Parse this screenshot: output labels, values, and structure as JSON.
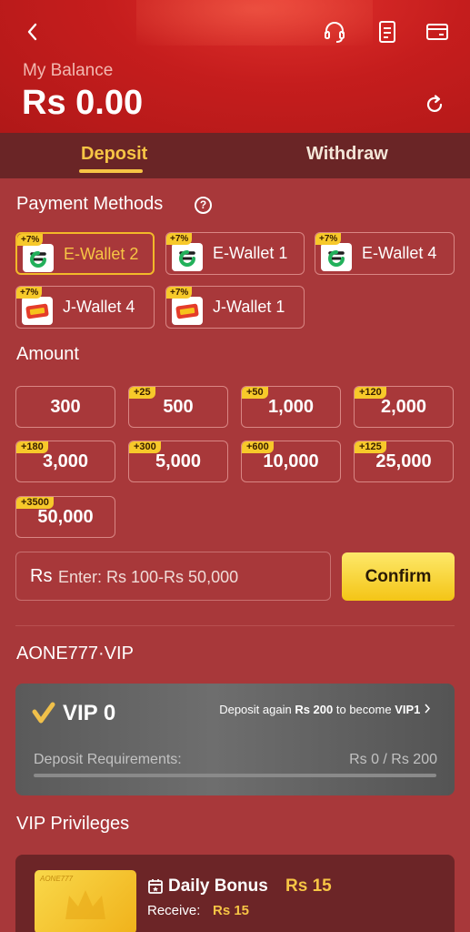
{
  "header": {
    "balance_label": "My Balance",
    "balance_value": "Rs 0.00",
    "icons": [
      "back-icon",
      "headset-icon",
      "document-icon",
      "wallet-icon",
      "refresh-icon"
    ]
  },
  "tabs": {
    "deposit": "Deposit",
    "withdraw": "Withdraw",
    "active": "Deposit"
  },
  "payment": {
    "title": "Payment Methods",
    "help_glyph": "?",
    "methods": [
      {
        "name": "E-Wallet 2",
        "badge": "+7%",
        "active": true,
        "logo": "easypaisa"
      },
      {
        "name": "E-Wallet 1",
        "badge": "+7%",
        "active": false,
        "logo": "easypaisa"
      },
      {
        "name": "E-Wallet 4",
        "badge": "+7%",
        "active": false,
        "logo": "easypaisa"
      },
      {
        "name": "J-Wallet 4",
        "badge": "+7%",
        "active": false,
        "logo": "jazzcash"
      },
      {
        "name": "J-Wallet 1",
        "badge": "+7%",
        "active": false,
        "logo": "jazzcash"
      }
    ]
  },
  "amount": {
    "title": "Amount",
    "options": [
      {
        "value": "300",
        "bonus": ""
      },
      {
        "value": "500",
        "bonus": "+25"
      },
      {
        "value": "1,000",
        "bonus": "+50"
      },
      {
        "value": "2,000",
        "bonus": "+120"
      },
      {
        "value": "3,000",
        "bonus": "+180"
      },
      {
        "value": "5,000",
        "bonus": "+300"
      },
      {
        "value": "10,000",
        "bonus": "+600"
      },
      {
        "value": "25,000",
        "bonus": "+125"
      },
      {
        "value": "50,000",
        "bonus": "+3500"
      }
    ],
    "currency_prefix": "Rs",
    "placeholder": "Enter: Rs 100-Rs 50,000",
    "confirm_label": "Confirm"
  },
  "vip": {
    "title": "AONE777·VIP",
    "level": "VIP 0",
    "next_prefix": "Deposit again ",
    "next_amount": "Rs 200",
    "next_middle": " to become ",
    "next_level": "VIP1",
    "requirements_label": "Deposit Requirements:",
    "requirements_value": "Rs 0 / Rs 200",
    "progress_fraction": 0
  },
  "privileges": {
    "title": "VIP Privileges",
    "image_brand": "AONE777",
    "bonus_title": "Daily Bonus",
    "bonus_amount": "Rs 15",
    "receive_label": "Receive:",
    "receive_value": "Rs 15"
  },
  "colors": {
    "background": "#a8383a",
    "header": "#c51d1d",
    "accent": "#f7c545",
    "tab_bar": "#6a2526"
  }
}
